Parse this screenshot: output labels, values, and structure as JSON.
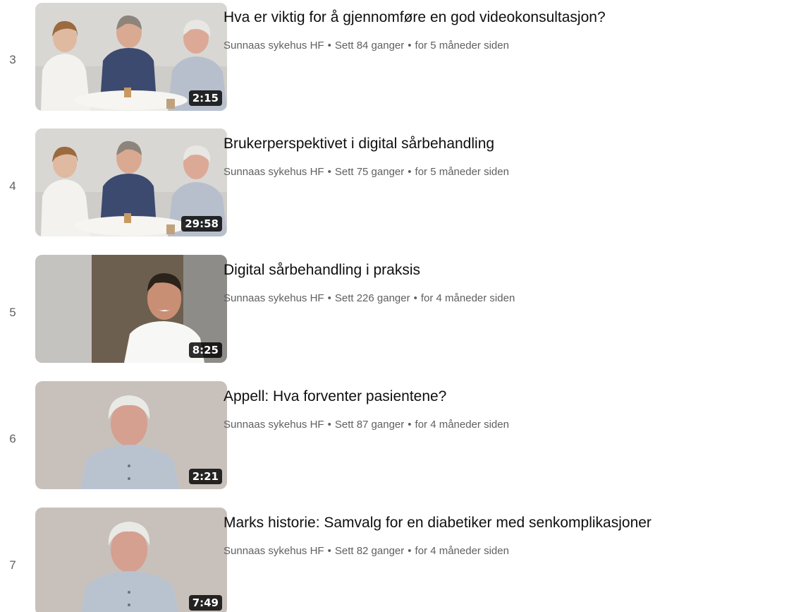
{
  "channel_name": "Sunnaas sykehus HF",
  "separator": "•",
  "videos": [
    {
      "index": "3",
      "title": "Hva er viktig for å gjennomføre en god videokonsultasjon?",
      "views": "Sett 84 ganger",
      "age": "for 5 måneder siden",
      "duration": "2:15",
      "scene": "three-people-table"
    },
    {
      "index": "4",
      "title": "Brukerperspektivet i digital sårbehandling",
      "views": "Sett 75 ganger",
      "age": "for 5 måneder siden",
      "duration": "29:58",
      "scene": "three-people-table"
    },
    {
      "index": "5",
      "title": "Digital sårbehandling i praksis",
      "views": "Sett 226 ganger",
      "age": "for 4 måneder siden",
      "duration": "8:25",
      "scene": "man-white-tshirt"
    },
    {
      "index": "6",
      "title": "Appell: Hva forventer pasientene?",
      "views": "Sett 87 ganger",
      "age": "for 4 måneder siden",
      "duration": "2:21",
      "scene": "grey-haired-man"
    },
    {
      "index": "7",
      "title": "Marks historie: Samvalg for en diabetiker med senkomplikasjoner",
      "views": "Sett 82 ganger",
      "age": "for 4 måneder siden",
      "duration": "7:49",
      "scene": "grey-haired-man"
    }
  ]
}
